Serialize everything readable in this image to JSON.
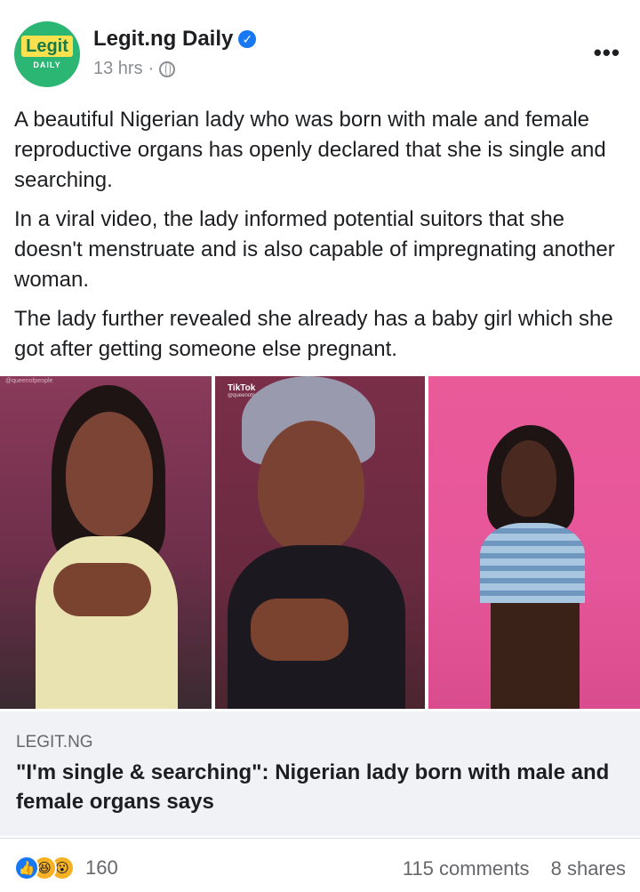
{
  "post": {
    "page_name": "Legit.ng Daily",
    "timestamp": "13 hrs",
    "separator": "·",
    "avatar_logo_top": "Legit",
    "avatar_logo_bottom": "DAILY",
    "paragraphs": [
      "A beautiful Nigerian lady who was born with male and female reproductive organs has openly declared that she is single and searching.",
      "In a viral video, the lady informed potential suitors that she doesn't menstruate and is also capable of impregnating another woman.",
      "The lady further revealed she already has a baby girl which she got after getting someone else pregnant."
    ]
  },
  "photos": {
    "tiktok_label": "TikTok",
    "tiktok_handle": "@queenofpeople",
    "watermark": "@queenofpeople"
  },
  "link": {
    "domain": "LEGIT.NG",
    "title": "\"I'm single & searching\": Nigerian lady born with male and female organs says"
  },
  "footer": {
    "reaction_count": "160",
    "comments": "115 comments",
    "shares": "8 shares"
  },
  "icons": {
    "verified": "verified-badge-icon",
    "globe": "globe-icon",
    "more": "more-options-icon",
    "like": "like-reaction-icon",
    "haha": "haha-reaction-icon",
    "wow": "wow-reaction-icon"
  },
  "colors": {
    "brand_green": "#2bb673",
    "brand_yellow": "#fbe14e",
    "facebook_blue": "#1877f2",
    "link_bg": "#f0f2f5"
  }
}
